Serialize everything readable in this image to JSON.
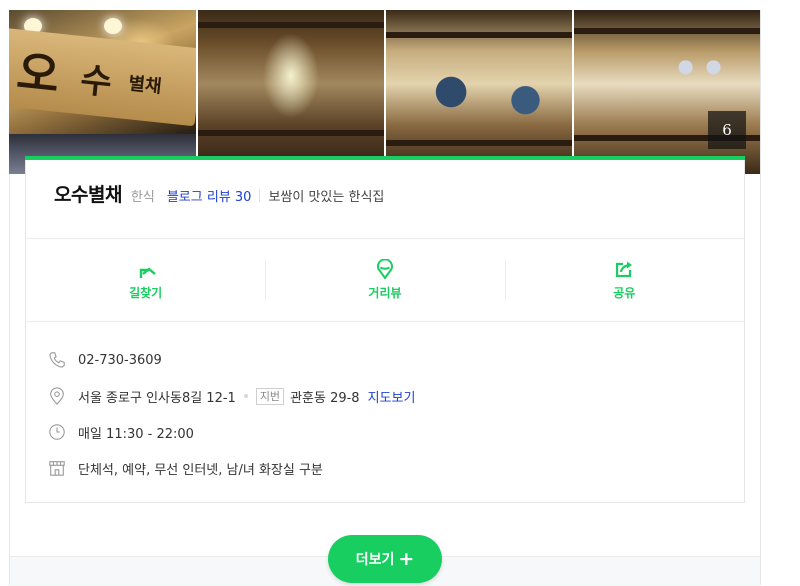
{
  "photos": {
    "count_badge": "6",
    "sign_text": [
      "오",
      "수",
      "별채"
    ]
  },
  "place": {
    "name": "오수별채",
    "category": "한식",
    "blog_review": "블로그 리뷰 30",
    "description": "보쌈이 맛있는 한식집"
  },
  "actions": [
    {
      "label": "길찾기",
      "icon": "directions-icon"
    },
    {
      "label": "거리뷰",
      "icon": "street-view-icon"
    },
    {
      "label": "공유",
      "icon": "share-icon"
    }
  ],
  "details": {
    "phone": "02-730-3609",
    "address": "서울 종로구 인사동8길 12-1",
    "jibun_badge": "지번",
    "jibun_address": "관훈동 29-8",
    "map_link": "지도보기",
    "hours": "매일 11:30 - 22:00",
    "facilities": "단체석, 예약, 무선 인터넷, 남/녀 화장실 구분"
  },
  "more_button": {
    "label": "더보기",
    "icon": "plus-icon"
  },
  "colors": {
    "accent": "#19ce60",
    "link": "#1c3fd1"
  }
}
